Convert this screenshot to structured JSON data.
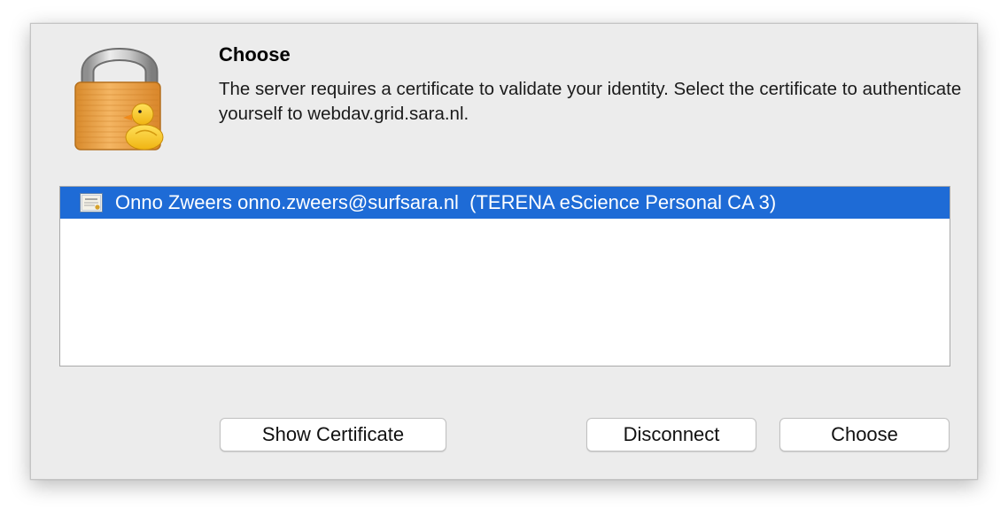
{
  "dialog": {
    "title": "Choose",
    "message": "The server requires a certificate to validate your identity. Select the certificate to authenticate yourself to webdav.grid.sara.nl.",
    "icon": "lock-duck-icon"
  },
  "certificates": [
    {
      "label": "Onno Zweers onno.zweers@surfsara.nl  (TERENA eScience Personal CA 3)",
      "icon": "certificate-icon",
      "selected": true
    }
  ],
  "buttons": {
    "show_certificate": "Show Certificate",
    "disconnect": "Disconnect",
    "choose": "Choose"
  },
  "colors": {
    "selection": "#1e6bd6",
    "dialog_background": "#ececec",
    "lock_body": "#f0a545",
    "duck": "#f6cd2b"
  }
}
